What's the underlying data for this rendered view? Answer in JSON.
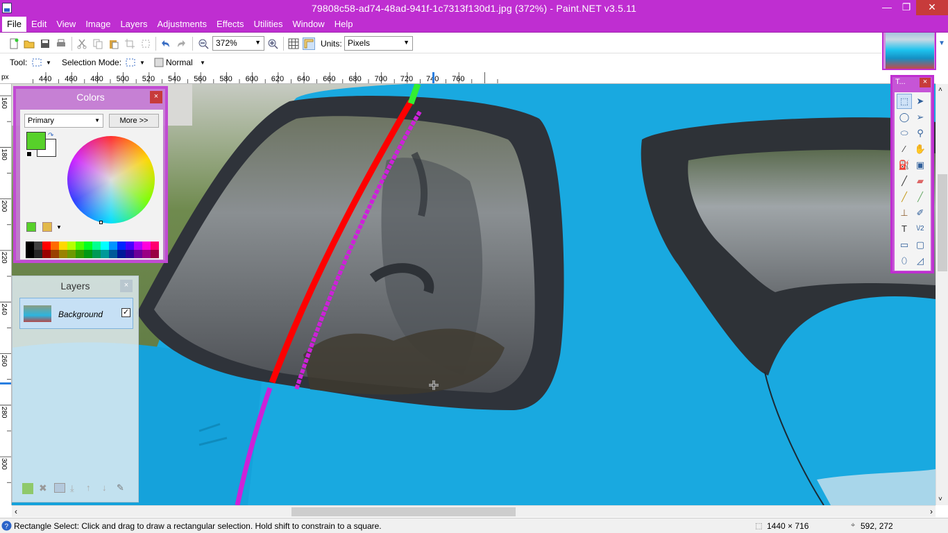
{
  "title": "79808c58-ad74-48ad-941f-1c7313f130d1.jpg (372%) - Paint.NET v3.5.11",
  "menu": [
    "File",
    "Edit",
    "View",
    "Image",
    "Layers",
    "Adjustments",
    "Effects",
    "Utilities",
    "Window",
    "Help"
  ],
  "toolbar": {
    "zoom": "372%",
    "units_label": "Units:",
    "units_value": "Pixels"
  },
  "toolbar2": {
    "tool_label": "Tool:",
    "selection_mode_label": "Selection Mode:",
    "blend_mode": "Normal"
  },
  "ruler": {
    "unit": "px",
    "h_ticks": [
      "440",
      "460",
      "480",
      "500",
      "520",
      "540",
      "560",
      "580",
      "600",
      "620",
      "640",
      "660",
      "680",
      "700",
      "720",
      "740",
      "760"
    ],
    "v_ticks": [
      "160",
      "180",
      "200",
      "220",
      "240",
      "260",
      "280",
      "300"
    ]
  },
  "colors_panel": {
    "title": "Colors",
    "mode": "Primary",
    "more_button": "More >>",
    "primary": "#57d12a",
    "secondary": "#ffffff"
  },
  "layers_panel": {
    "title": "Layers",
    "layers": [
      {
        "name": "Background",
        "visible": true
      }
    ]
  },
  "tools_panel": {
    "title": "T..."
  },
  "status": {
    "hint": "Rectangle Select: Click and drag to draw a rectangular selection. Hold shift to constrain to a square.",
    "image_size": "1440 × 716",
    "cursor_pos": "592, 272"
  },
  "palette": [
    "#000000",
    "#404040",
    "#ff0000",
    "#ff6a00",
    "#ffd800",
    "#b6ff00",
    "#4cff00",
    "#00ff21",
    "#00ff90",
    "#00ffff",
    "#0094ff",
    "#0026ff",
    "#4800ff",
    "#b200ff",
    "#ff00dc",
    "#ff006e"
  ],
  "accent": "#bf2ed1"
}
